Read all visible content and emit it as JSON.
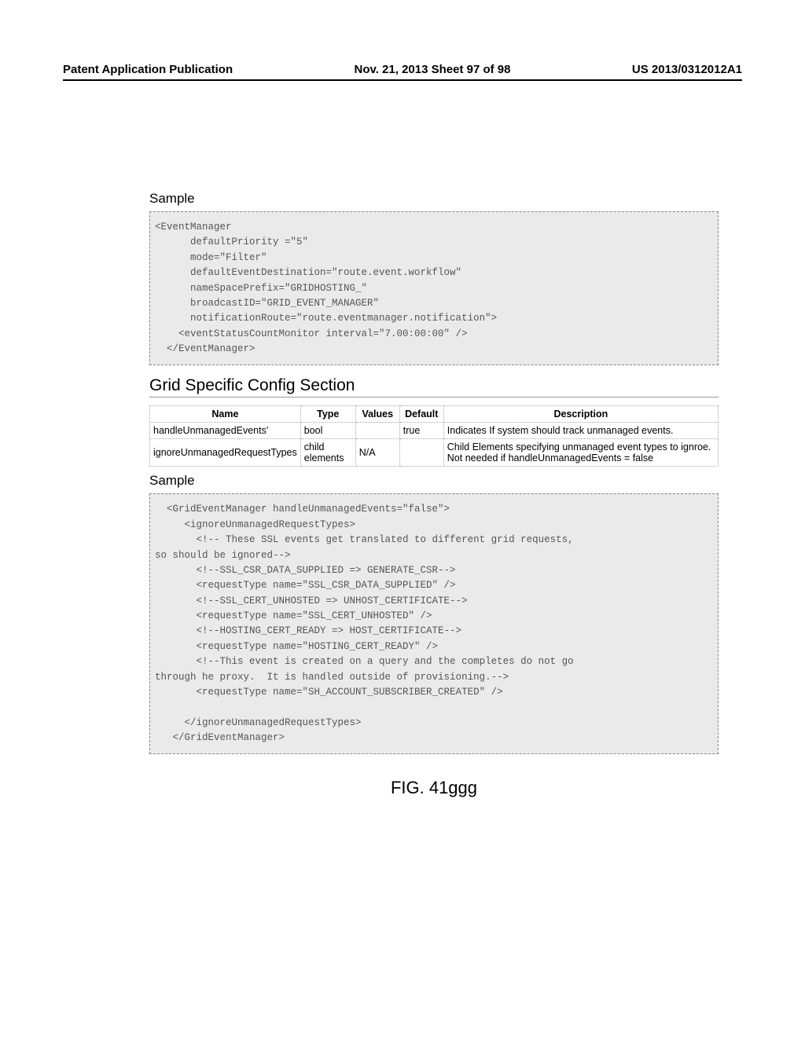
{
  "header": {
    "left": "Patent Application Publication",
    "center": "Nov. 21, 2013  Sheet 97 of 98",
    "right": "US 2013/0312012A1"
  },
  "sample1": {
    "heading": "Sample",
    "code": "<EventManager\n      defaultPriority =\"5\"\n      mode=\"Filter\"\n      defaultEventDestination=\"route.event.workflow\"\n      nameSpacePrefix=\"GRIDHOSTING_\"\n      broadcastID=\"GRID_EVENT_MANAGER\"\n      notificationRoute=\"route.eventmanager.notification\">\n    <eventStatusCountMonitor interval=\"7.00:00:00\" />\n  </EventManager>"
  },
  "section": {
    "title": "Grid Specific Config Section",
    "table": {
      "headers": {
        "name": "Name",
        "type": "Type",
        "values": "Values",
        "default": "Default",
        "description": "Description"
      },
      "rows": [
        {
          "name": "handleUnmanagedEvents'",
          "type": "bool",
          "values": "",
          "default": "true",
          "description": "Indicates If system should track unmanaged events."
        },
        {
          "name": "ignoreUnmanagedRequestTypes",
          "type": "child elements",
          "values": "N/A",
          "default": "",
          "description": "Child Elements specifying unmanaged event types to ignroe. Not needed if handleUnmanagedEvents = false"
        }
      ]
    }
  },
  "sample2": {
    "heading": "Sample",
    "code": "  <GridEventManager handleUnmanagedEvents=\"false\">\n     <ignoreUnmanagedRequestTypes>\n       <!-- These SSL events get translated to different grid requests,\nso should be ignored-->\n       <!--SSL_CSR_DATA_SUPPLIED => GENERATE_CSR-->\n       <requestType name=\"SSL_CSR_DATA_SUPPLIED\" />\n       <!--SSL_CERT_UNHOSTED => UNHOST_CERTIFICATE-->\n       <requestType name=\"SSL_CERT_UNHOSTED\" />\n       <!--HOSTING_CERT_READY => HOST_CERTIFICATE-->\n       <requestType name=\"HOSTING_CERT_READY\" />\n       <!--This event is created on a query and the completes do not go\nthrough he proxy.  It is handled outside of provisioning.-->\n       <requestType name=\"SH_ACCOUNT_SUBSCRIBER_CREATED\" />\n\n     </ignoreUnmanagedRequestTypes>\n   </GridEventManager>"
  },
  "figure": {
    "label": "FIG. 41ggg"
  }
}
